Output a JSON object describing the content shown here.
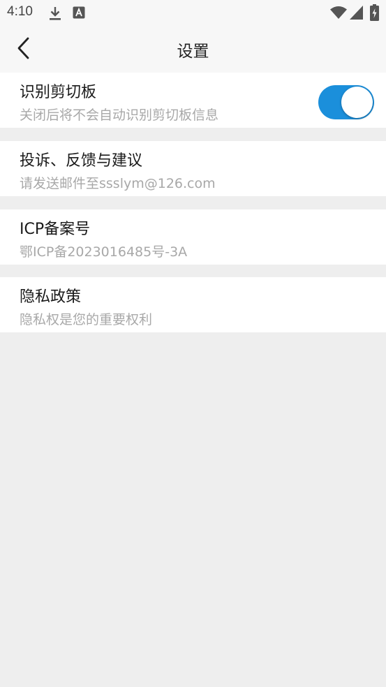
{
  "status_bar": {
    "time": "4:10",
    "icons": [
      "download-icon",
      "font-a-icon",
      "wifi-icon",
      "signal-icon",
      "battery-charging-icon"
    ]
  },
  "header": {
    "back_icon": "chevron-left-icon",
    "title": "设置"
  },
  "settings": [
    {
      "title": "识别剪切板",
      "subtitle": "关闭后将不会自动识别剪切板信息",
      "toggle_on": true
    },
    {
      "title": "投诉、反馈与建议",
      "subtitle": "请发送邮件至ssslym@126.com"
    },
    {
      "title": "ICP备案号",
      "subtitle": "鄂ICP备2023016485号-3A"
    },
    {
      "title": "隐私政策",
      "subtitle": "隐私权是您的重要权利"
    }
  ],
  "colors": {
    "accent": "#1b8fdb",
    "page_background": "#eeeeee",
    "card_background": "#ffffff",
    "subtitle_text": "#a8a8a8"
  }
}
